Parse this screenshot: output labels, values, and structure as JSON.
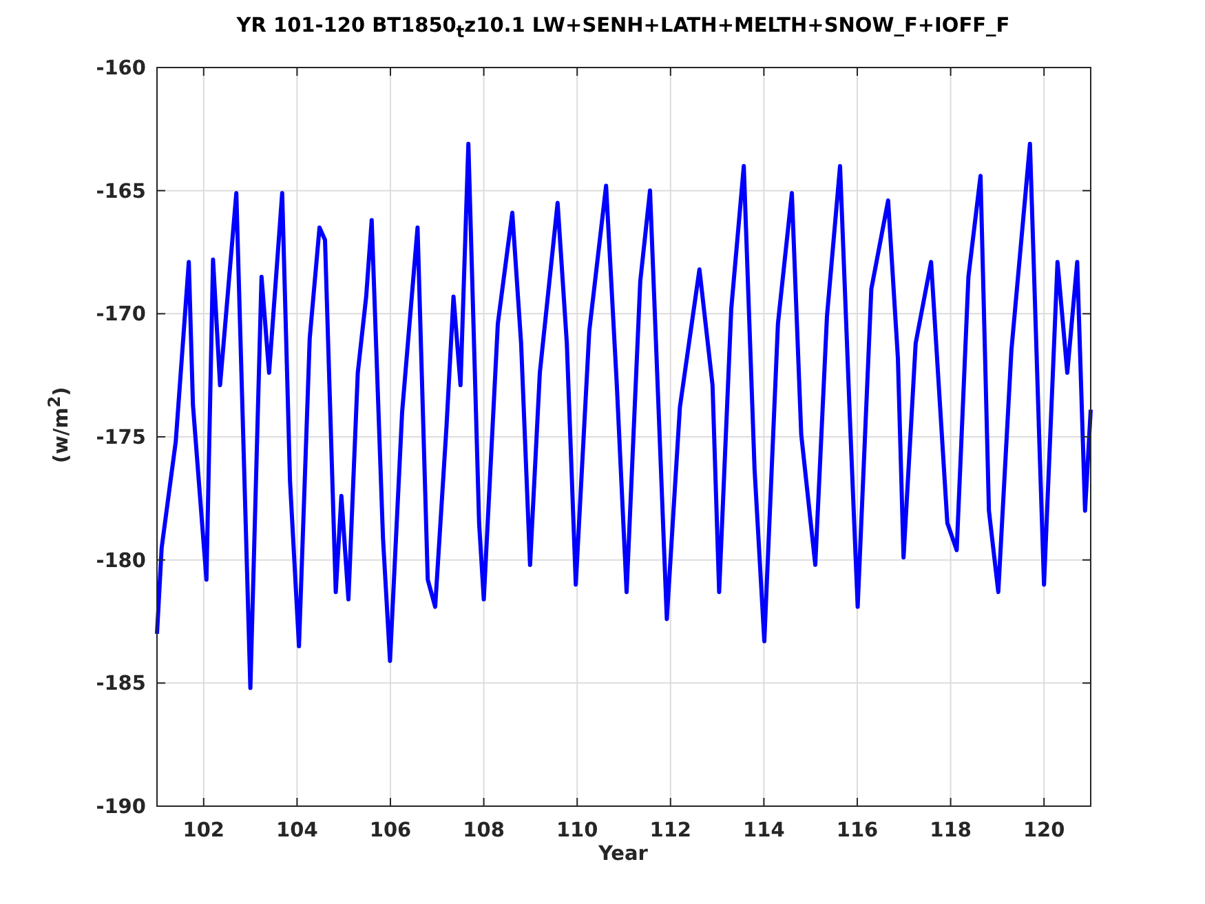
{
  "figure": {
    "title": "YR 101-120 BT1850$_{t}$z10.1 LW+SENH+LATH+MELTH+SNOW_F+IOFF_F",
    "chart_data": {
      "type": "line",
      "grid": true,
      "xlabel": "Year",
      "ylabel": "(w/m$^{2}$)",
      "xlim": [
        101,
        121
      ],
      "ylim": [
        -190,
        -160
      ],
      "xticks": [
        102,
        104,
        106,
        108,
        110,
        112,
        114,
        116,
        118,
        120
      ],
      "yticks": [
        -190,
        -185,
        -180,
        -175,
        -170,
        -165,
        -160
      ],
      "x": [
        101.0,
        101.1,
        101.4,
        101.68,
        101.77,
        102.06,
        102.2,
        102.35,
        102.7,
        103.0,
        103.24,
        103.4,
        103.68,
        103.85,
        104.04,
        104.27,
        104.48,
        104.6,
        104.83,
        104.95,
        105.1,
        105.3,
        105.48,
        105.6,
        105.84,
        105.99,
        106.25,
        106.58,
        106.8,
        106.96,
        107.2,
        107.35,
        107.5,
        107.67,
        107.9,
        108.0,
        108.3,
        108.61,
        108.8,
        108.99,
        109.2,
        109.58,
        109.78,
        109.97,
        110.26,
        110.62,
        110.85,
        111.06,
        111.35,
        111.56,
        111.92,
        112.2,
        112.62,
        112.9,
        113.04,
        113.3,
        113.57,
        113.8,
        114.01,
        114.3,
        114.6,
        114.8,
        115.1,
        115.35,
        115.63,
        115.85,
        116.01,
        116.3,
        116.66,
        116.87,
        116.99,
        117.25,
        117.58,
        117.93,
        118.13,
        118.38,
        118.64,
        118.82,
        119.02,
        119.3,
        119.7,
        119.91,
        120.0,
        120.29,
        120.5,
        120.71,
        120.88,
        121.0
      ],
      "series": [
        {
          "color": "#0000ff",
          "values": [
            -183,
            -179.5,
            -175.2,
            -167.9,
            -173.7,
            -180.8,
            -167.8,
            -172.9,
            -165.1,
            -185.2,
            -168.5,
            -172.4,
            -165.1,
            -176.8,
            -183.5,
            -171,
            -166.5,
            -167,
            -181.3,
            -177.4,
            -181.6,
            -172.4,
            -169.3,
            -166.2,
            -179.1,
            -184.1,
            -174,
            -166.5,
            -180.8,
            -181.9,
            -174.6,
            -169.3,
            -172.9,
            -163.1,
            -178.5,
            -181.6,
            -170.4,
            -165.9,
            -171.2,
            -180.2,
            -172.4,
            -165.5,
            -171.2,
            -181,
            -170.7,
            -164.8,
            -172.9,
            -181.3,
            -168.7,
            -165,
            -182.4,
            -173.8,
            -168.2,
            -172.9,
            -181.3,
            -169.8,
            -164,
            -176.3,
            -183.3,
            -170.4,
            -165.1,
            -174.9,
            -180.2,
            -170.1,
            -164,
            -174.6,
            -181.9,
            -169,
            -165.4,
            -171.8,
            -179.9,
            -171.2,
            -167.9,
            -178.5,
            -179.6,
            -168.5,
            -164.4,
            -178,
            -181.3,
            -171.5,
            -163.1,
            -175.7,
            -181,
            -167.9,
            -172.4,
            -167.9,
            -178,
            -173.9
          ]
        }
      ]
    }
  }
}
